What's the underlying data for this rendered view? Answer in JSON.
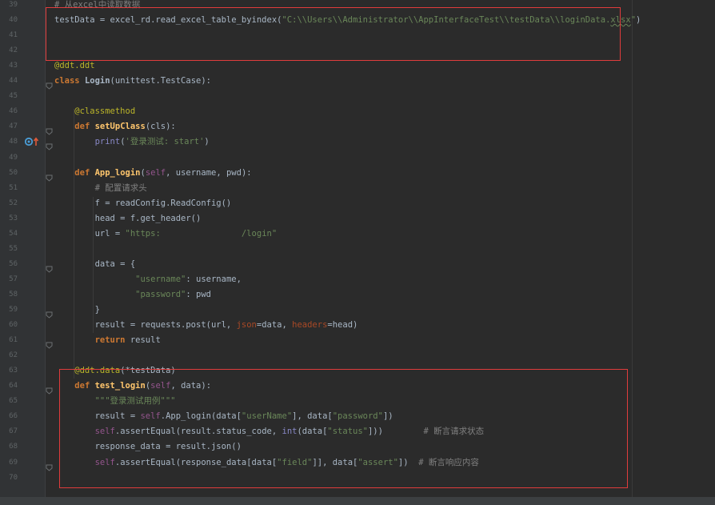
{
  "lines": [
    {
      "n": "39",
      "tokens": [
        {
          "t": "# 从excel中读取数据",
          "c": "c"
        }
      ]
    },
    {
      "n": "40",
      "tokens": [
        {
          "t": "testData = excel_rd.read_excel_table_byindex(",
          "c": ""
        },
        {
          "t": "\"C:\\\\Users\\\\Administrator\\\\AppInterfaceTest\\\\testData\\\\loginData.",
          "c": "s"
        },
        {
          "t": "xlsx",
          "c": "s wavy"
        },
        {
          "t": "\"",
          "c": "s"
        },
        {
          "t": ")",
          "c": ""
        }
      ]
    },
    {
      "n": "41",
      "tokens": []
    },
    {
      "n": "42",
      "tokens": []
    },
    {
      "n": "43",
      "tokens": [
        {
          "t": "@ddt.ddt",
          "c": "deco"
        }
      ]
    },
    {
      "n": "44",
      "tokens": [
        {
          "t": "class ",
          "c": "k"
        },
        {
          "t": "Login",
          "c": "cls"
        },
        {
          "t": "(unittest.TestCase):",
          "c": ""
        }
      ]
    },
    {
      "n": "45",
      "tokens": []
    },
    {
      "n": "46",
      "tokens": [
        {
          "t": "    @classmethod",
          "c": "deco"
        }
      ]
    },
    {
      "n": "47",
      "tokens": [
        {
          "t": "    ",
          "c": ""
        },
        {
          "t": "def ",
          "c": "k"
        },
        {
          "t": "setUpClass",
          "c": "def-fn"
        },
        {
          "t": "(cls):",
          "c": ""
        }
      ]
    },
    {
      "n": "48",
      "tokens": [
        {
          "t": "        ",
          "c": ""
        },
        {
          "t": "print",
          "c": "bi"
        },
        {
          "t": "(",
          "c": ""
        },
        {
          "t": "'登录测试: start'",
          "c": "s"
        },
        {
          "t": ")",
          "c": ""
        }
      ]
    },
    {
      "n": "49",
      "tokens": []
    },
    {
      "n": "50",
      "tokens": [
        {
          "t": "    ",
          "c": ""
        },
        {
          "t": "def ",
          "c": "k"
        },
        {
          "t": "App_login",
          "c": "def-fn"
        },
        {
          "t": "(",
          "c": ""
        },
        {
          "t": "self",
          "c": "self"
        },
        {
          "t": ", username, pwd):",
          "c": ""
        }
      ]
    },
    {
      "n": "51",
      "tokens": [
        {
          "t": "        # 配置请求头",
          "c": "c"
        }
      ]
    },
    {
      "n": "52",
      "tokens": [
        {
          "t": "        f = readConfig.ReadConfig()",
          "c": ""
        }
      ]
    },
    {
      "n": "53",
      "tokens": [
        {
          "t": "        head = f.get_header()",
          "c": ""
        }
      ]
    },
    {
      "n": "54",
      "tokens": [
        {
          "t": "        url = ",
          "c": ""
        },
        {
          "t": "\"https:                /login\"",
          "c": "s"
        }
      ]
    },
    {
      "n": "55",
      "tokens": []
    },
    {
      "n": "56",
      "tokens": [
        {
          "t": "        data = {",
          "c": ""
        }
      ]
    },
    {
      "n": "57",
      "tokens": [
        {
          "t": "                ",
          "c": ""
        },
        {
          "t": "\"username\"",
          "c": "s"
        },
        {
          "t": ": username,",
          "c": ""
        }
      ]
    },
    {
      "n": "58",
      "tokens": [
        {
          "t": "                ",
          "c": ""
        },
        {
          "t": "\"password\"",
          "c": "s"
        },
        {
          "t": ": pwd",
          "c": ""
        }
      ]
    },
    {
      "n": "59",
      "tokens": [
        {
          "t": "        }",
          "c": ""
        }
      ]
    },
    {
      "n": "60",
      "tokens": [
        {
          "t": "        result = requests.post(url, ",
          "c": ""
        },
        {
          "t": "json",
          "c": "kw"
        },
        {
          "t": "=data, ",
          "c": ""
        },
        {
          "t": "headers",
          "c": "kw"
        },
        {
          "t": "=head)",
          "c": ""
        }
      ]
    },
    {
      "n": "61",
      "tokens": [
        {
          "t": "        ",
          "c": ""
        },
        {
          "t": "return ",
          "c": "k"
        },
        {
          "t": "result",
          "c": ""
        }
      ]
    },
    {
      "n": "62",
      "tokens": []
    },
    {
      "n": "63",
      "tokens": [
        {
          "t": "    @ddt.data",
          "c": "deco"
        },
        {
          "t": "(*testData)",
          "c": ""
        }
      ]
    },
    {
      "n": "64",
      "tokens": [
        {
          "t": "    ",
          "c": ""
        },
        {
          "t": "def ",
          "c": "k"
        },
        {
          "t": "test_login",
          "c": "def-fn"
        },
        {
          "t": "(",
          "c": ""
        },
        {
          "t": "self",
          "c": "self"
        },
        {
          "t": ", data):",
          "c": ""
        }
      ]
    },
    {
      "n": "65",
      "tokens": [
        {
          "t": "        ",
          "c": ""
        },
        {
          "t": "\"\"\"登录测试用例\"\"\"",
          "c": "s"
        }
      ]
    },
    {
      "n": "66",
      "tokens": [
        {
          "t": "        result = ",
          "c": ""
        },
        {
          "t": "self",
          "c": "self"
        },
        {
          "t": ".App_login(data[",
          "c": ""
        },
        {
          "t": "\"userName\"",
          "c": "s"
        },
        {
          "t": "], data[",
          "c": ""
        },
        {
          "t": "\"password\"",
          "c": "s"
        },
        {
          "t": "])",
          "c": ""
        }
      ]
    },
    {
      "n": "67",
      "tokens": [
        {
          "t": "        ",
          "c": ""
        },
        {
          "t": "self",
          "c": "self"
        },
        {
          "t": ".assertEqual(result.status_code, ",
          "c": ""
        },
        {
          "t": "int",
          "c": "bi"
        },
        {
          "t": "(data[",
          "c": ""
        },
        {
          "t": "\"status\"",
          "c": "s"
        },
        {
          "t": "]))        ",
          "c": ""
        },
        {
          "t": "# 断言请求状态",
          "c": "c"
        }
      ]
    },
    {
      "n": "68",
      "tokens": [
        {
          "t": "        response_data = result.json()",
          "c": ""
        }
      ]
    },
    {
      "n": "69",
      "tokens": [
        {
          "t": "        ",
          "c": ""
        },
        {
          "t": "self",
          "c": "self"
        },
        {
          "t": ".assertEqual(response_data[data[",
          "c": ""
        },
        {
          "t": "\"field\"",
          "c": "s"
        },
        {
          "t": "]], data[",
          "c": ""
        },
        {
          "t": "\"assert\"",
          "c": "s"
        },
        {
          "t": "])  ",
          "c": ""
        },
        {
          "t": "# 断言响应内容",
          "c": "c"
        }
      ]
    },
    {
      "n": "70",
      "tokens": []
    }
  ],
  "colors": {
    "background": "#2b2b2b",
    "gutter": "#313335",
    "keyword": "#cc7832",
    "string": "#6a8759",
    "comment": "#808080",
    "decorator": "#bbb529",
    "self": "#94558d",
    "highlight_box": "#e03c3c"
  },
  "icons": [
    "override-icon",
    "fold-icon"
  ]
}
